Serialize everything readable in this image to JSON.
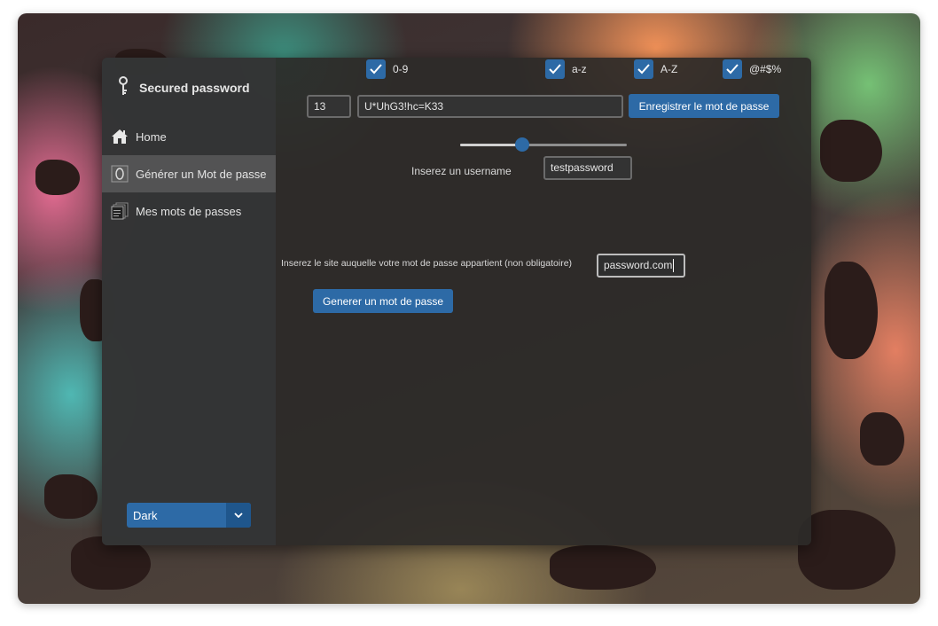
{
  "app": {
    "title": "Secured password"
  },
  "sidebar": {
    "items": [
      {
        "label": "Home",
        "icon": "home-icon",
        "active": false
      },
      {
        "label": "Générer un Mot de passe",
        "icon": "password-icon",
        "active": true
      },
      {
        "label": "Mes mots de passes",
        "icon": "documents-icon",
        "active": false
      }
    ],
    "theme_select": {
      "value": "Dark"
    }
  },
  "options": {
    "checkboxes": [
      {
        "label": "0-9",
        "checked": true
      },
      {
        "label": "a-z",
        "checked": true
      },
      {
        "label": "A-Z",
        "checked": true
      },
      {
        "label": "@#$%",
        "checked": true
      }
    ]
  },
  "generator": {
    "length": "13",
    "password": "U*UhG3!hc=K33",
    "save_button": "Enregistrer le mot de passe",
    "slider_fraction": 0.37,
    "username_label": "Inserez un username",
    "username_value": "testpassword",
    "site_label": "Inserez le site auquelle votre mot de passe appartient (non obligatoire)",
    "site_value": "password.com",
    "generate_button": "Generer un mot de passe"
  },
  "colors": {
    "accent": "#2d6aa6",
    "accent_dark": "#1f568c"
  }
}
